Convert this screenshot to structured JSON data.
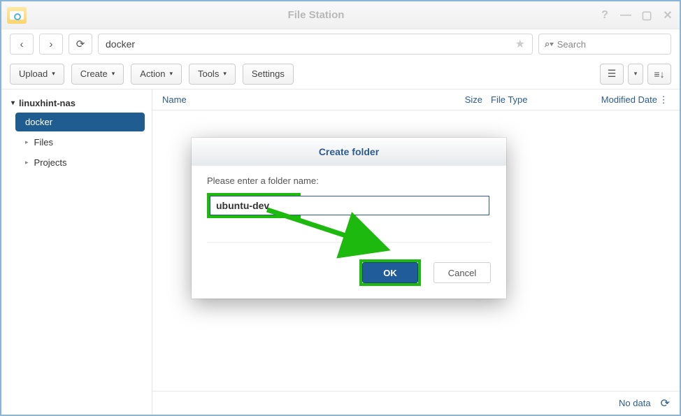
{
  "window": {
    "title": "File Station"
  },
  "nav": {
    "path": "docker"
  },
  "search": {
    "placeholder": "Search"
  },
  "toolbar": {
    "upload": "Upload",
    "create": "Create",
    "action": "Action",
    "tools": "Tools",
    "settings": "Settings"
  },
  "sidebar": {
    "root": "linuxhint-nas",
    "items": [
      {
        "label": "docker",
        "selected": true
      },
      {
        "label": "Files",
        "selected": false
      },
      {
        "label": "Projects",
        "selected": false
      }
    ]
  },
  "columns": {
    "name": "Name",
    "size": "Size",
    "type": "File Type",
    "modified": "Modified Date"
  },
  "footer": {
    "status": "No data"
  },
  "dialog": {
    "title": "Create folder",
    "label": "Please enter a folder name:",
    "value": "ubuntu-dev",
    "ok": "OK",
    "cancel": "Cancel"
  }
}
